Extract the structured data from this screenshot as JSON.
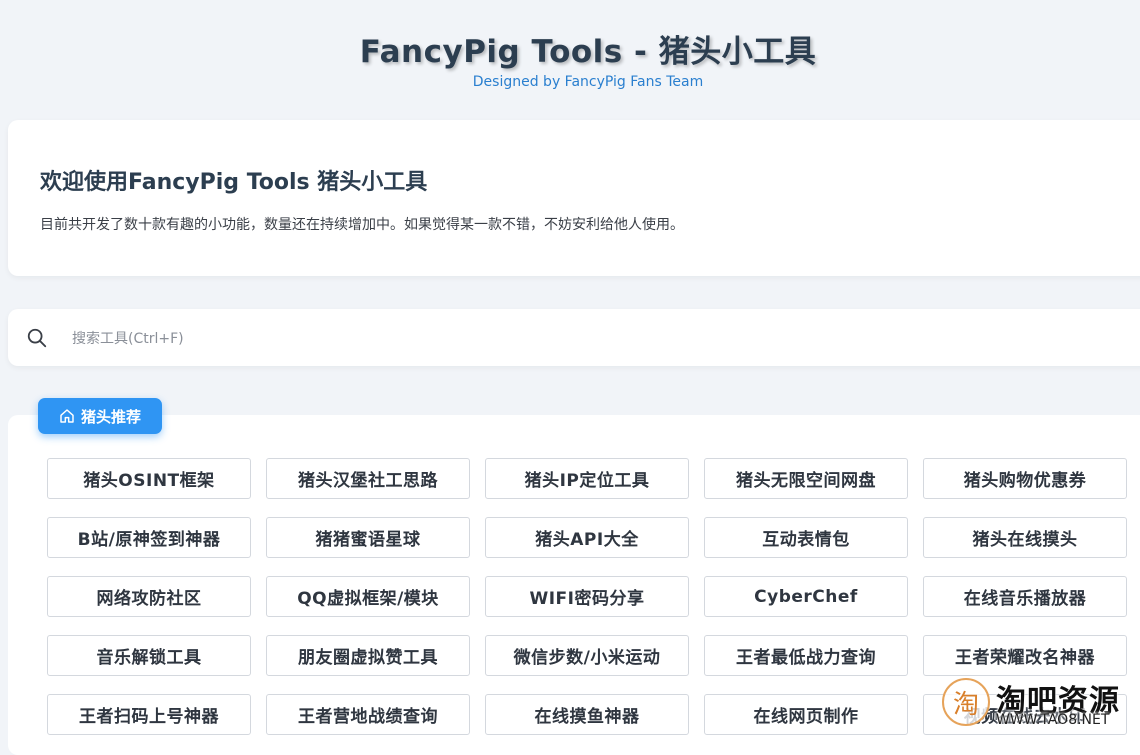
{
  "header": {
    "title": "FancyPig Tools - 猪头小工具",
    "subtitle": "Designed by FancyPig Fans Team"
  },
  "welcome": {
    "title": "欢迎使用FancyPig Tools 猪头小工具",
    "description": "目前共开发了数十款有趣的小功能，数量还在持续增加中。如果觉得某一款不错，不妨安利给他人使用。"
  },
  "search": {
    "icon": "search-icon",
    "placeholder": "搜索工具(Ctrl+F)",
    "value": ""
  },
  "category": {
    "label": "猪头推荐",
    "icon": "home-icon",
    "color": "#2f95f3"
  },
  "tools": [
    "猪头OSINT框架",
    "猪头汉堡社工思路",
    "猪头IP定位工具",
    "猪头无限空间网盘",
    "猪头购物优惠券",
    "B站/原神签到神器",
    "猪猪蜜语星球",
    "猪头API大全",
    "互动表情包",
    "猪头在线摸头",
    "网络攻防社区",
    "QQ虚拟框架/模块",
    "WIFI密码分享",
    "CyberChef",
    "在线音乐播放器",
    "音乐解锁工具",
    "朋友圈虚拟赞工具",
    "微信步数/小米运动",
    "王者最低战力查询",
    "王者荣耀改名神器",
    "王者扫码上号神器",
    "王者营地战绩查询",
    "在线摸鱼神器",
    "在线网页制作",
    "视频在线去水印"
  ],
  "watermark": {
    "logo_char": "淘",
    "text": "淘吧资源",
    "url": "WWW.TAO8.NET"
  }
}
